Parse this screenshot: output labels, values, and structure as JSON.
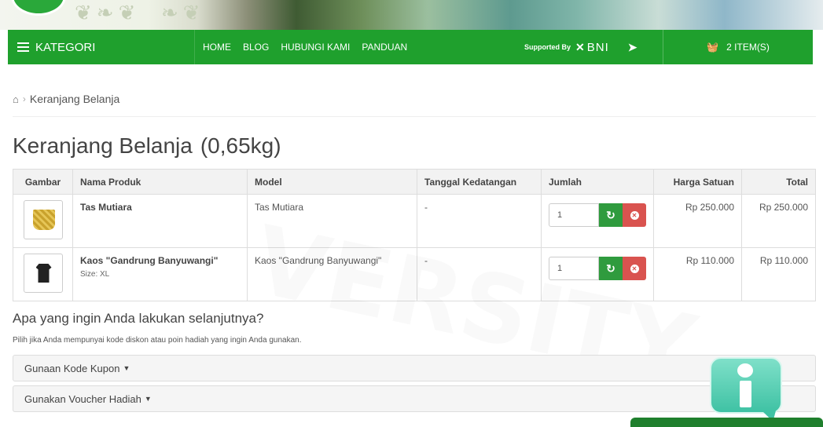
{
  "header": {
    "kategori_label": "KATEGORI",
    "menu": [
      "HOME",
      "BLOG",
      "HUBUNGI KAMI",
      "PANDUAN"
    ],
    "supported_by": "Supported By",
    "bni_label": "BNI",
    "cart_label": "2 ITEM(S)"
  },
  "breadcrumb": {
    "current": "Keranjang Belanja"
  },
  "page": {
    "title": "Keranjang Belanja",
    "weight": "(0,65kg)"
  },
  "table": {
    "headers": [
      "Gambar",
      "Nama Produk",
      "Model",
      "Tanggal Kedatangan",
      "Jumlah",
      "Harga Satuan",
      "Total"
    ],
    "rows": [
      {
        "name": "Tas Mutiara",
        "size": "",
        "model": "Tas Mutiara",
        "date": "-",
        "qty": "1",
        "price": "Rp 250.000",
        "total": "Rp 250.000"
      },
      {
        "name": "Kaos \"Gandrung Banyuwangi\"",
        "size": "Size: XL",
        "model": "Kaos \"Gandrung Banyuwangi\"",
        "date": "-",
        "qty": "1",
        "price": "Rp 110.000",
        "total": "Rp 110.000"
      }
    ]
  },
  "next": {
    "heading": "Apa yang ingin Anda lakukan selanjutnya?",
    "text": "Pilih jika Anda mempunyai kode diskon atau poin hadiah yang ingin Anda gunakan.",
    "panel_coupon": "Gunaan Kode Kupon",
    "panel_voucher": "Gunakan Voucher Hadiah"
  },
  "colors": {
    "nav": "#1fa02d",
    "update": "#2f9b3e",
    "remove": "#d9534f"
  },
  "icons": {
    "menu": "bars-icon",
    "home": "home-icon",
    "cart": "basket-icon",
    "refresh": "refresh-icon",
    "remove": "times-circle-icon",
    "info": "info-icon"
  }
}
